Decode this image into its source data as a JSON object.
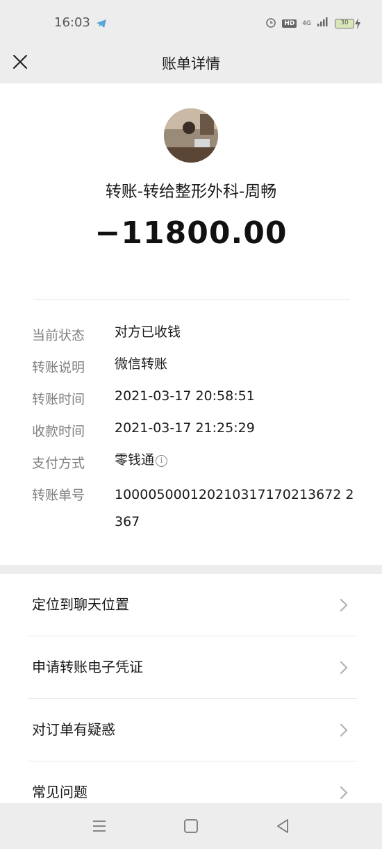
{
  "status_bar": {
    "time": "16:03",
    "hd": "HD",
    "network": "4G",
    "battery": "30"
  },
  "header": {
    "title": "账单详情"
  },
  "transaction": {
    "title": "转账-转给整形外科-周畅",
    "amount": "−11800.00"
  },
  "details": [
    {
      "label": "当前状态",
      "value": "对方已收钱"
    },
    {
      "label": "转账说明",
      "value": "微信转账"
    },
    {
      "label": "转账时间",
      "value": "2021-03-17 20:58:51"
    },
    {
      "label": "收款时间",
      "value": "2021-03-17 21:25:29"
    },
    {
      "label": "支付方式",
      "value": "零钱通"
    },
    {
      "label": "转账单号",
      "value": "100005000120210317170213672 2367"
    }
  ],
  "info_icon_glyph": "i",
  "actions": [
    {
      "label": "定位到聊天位置"
    },
    {
      "label": "申请转账电子凭证"
    },
    {
      "label": "对订单有疑惑"
    },
    {
      "label": "常见问题"
    }
  ],
  "colors": {
    "background": "#ededed",
    "card": "#ffffff",
    "label": "#808080",
    "text": "#1a1a1a"
  }
}
